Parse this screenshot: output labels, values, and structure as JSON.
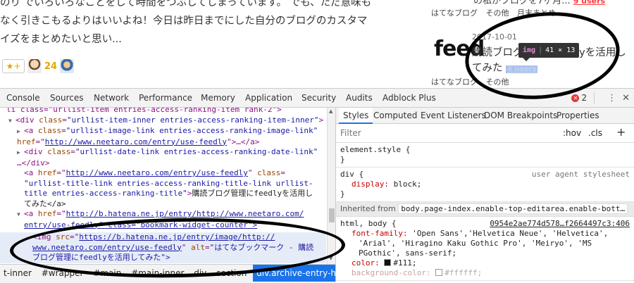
{
  "blog": {
    "post_lines": [
      "のり でいろいろなことをして時間をつぶしてしまっています。 でも、ただ意味も",
      "なく引きこもるよりはいいよね！今日は昨日までにした自分のブログのカスタマ",
      "イズをまとめたいと思い..."
    ],
    "star_button": "★+",
    "star_count": "24"
  },
  "sidebar": {
    "prev_title": "の私がブログを7ヶ月...",
    "prev_users": "9 users",
    "prev_tags": [
      "はてなブログ",
      "その他",
      "月末まとめ"
    ],
    "feedly_logo": "feed",
    "entry_date": "2017-10-01",
    "entry_title": "購読ブログ管理にfeedlyを活用してみた",
    "entry_users": "4 users",
    "entry_tags": [
      "はてなブログ",
      "その他"
    ]
  },
  "tooltip": {
    "tag": "img",
    "size": "41 × 13"
  },
  "devtools": {
    "tabs": [
      "Console",
      "Sources",
      "Network",
      "Performance",
      "Memory",
      "Application",
      "Security",
      "Audits",
      "Adblock Plus"
    ],
    "error_count": "2",
    "elements": {
      "line1": "li class=\"urllist-item entries-access-ranking-item rank-2\">",
      "line2_tag": "div",
      "line2_attr": "class",
      "line2_val": "\"urllist-item-inner entries-access-ranking-item-inner\"",
      "line3_tag": "a",
      "line3_attr": "class",
      "line3_val": "\"urllist-image-link entries-access-ranking-image-link\"",
      "line4_attr": "href",
      "line4_url": "http://www.neetaro.com/entry/use-feedly",
      "line4_rest": "…</a>",
      "line5_tag": "div",
      "line5_attr": "class",
      "line5_val": "\"urllist-date-link entries-access-ranking-date-link\"",
      "line6": "…</div>",
      "line7_tag": "a",
      "line7_attr": "href",
      "line7_url": "http://www.neetaro.com/entry/use-feedly",
      "line7_attr2": "class",
      "line8": "\"urllist-title-link entries-access-ranking-title-link  urllist-",
      "line9_val": "title entries-access-ranking-title\"",
      "line9_text": "購読ブログ管理にfeedlyを活用し",
      "line10": "てみた</a>",
      "line11_tag": "a",
      "line11_attr": "href",
      "line11_url": "http://b.hatena.ne.jp/entry/http://www.neetaro.com/",
      "line12": "entry/use-feedly\" class=\"bookmark-widget-counter\">",
      "line13_tag": "img",
      "line13_attr": "src",
      "line13_url": "https://b.hatena.ne.jp/entry/image/http://",
      "line14_url": "www.neetaro.com/entry/use-feedly",
      "line14_attr": "alt",
      "line14_val": "\"はてなブックマーク - 購読",
      "line15": "ブログ管理にfeedlyを活用してみた\">"
    },
    "breadcrumbs": [
      "t-inner",
      "#wrapper",
      "#main",
      "#main-inner",
      "div",
      "section",
      "div.archive-entry-header"
    ],
    "styles": {
      "tabs": [
        "Styles",
        "Computed",
        "Event Listeners",
        "DOM Breakpoints",
        "Properties"
      ],
      "filter_placeholder": "Filter",
      "hov": ":hov",
      "cls": ".cls",
      "element_style": "element.style {",
      "div_selector": "div {",
      "div_origin": "user agent stylesheet",
      "display_prop": "display",
      "display_val": "block;",
      "inherited_label": "Inherited from",
      "inherited_src": "body.page-index.enable-top-editarea.enable-bott…",
      "html_body": "html, body {",
      "html_origin": "0954e2ae774d578…f2664497c3:406",
      "font_prop": "font-family",
      "font_val1": "'Open Sans','Helvetica Neue', 'Helvetica',",
      "font_val2": "'Arial', 'Hiragino Kaku Gothic Pro', 'Meiryo', 'MS",
      "font_val3": "PGothic', sans-serif;",
      "color_prop": "color",
      "color_val": "#111;",
      "bg_prop": "background-color",
      "bg_val": "#ffffff;"
    }
  }
}
